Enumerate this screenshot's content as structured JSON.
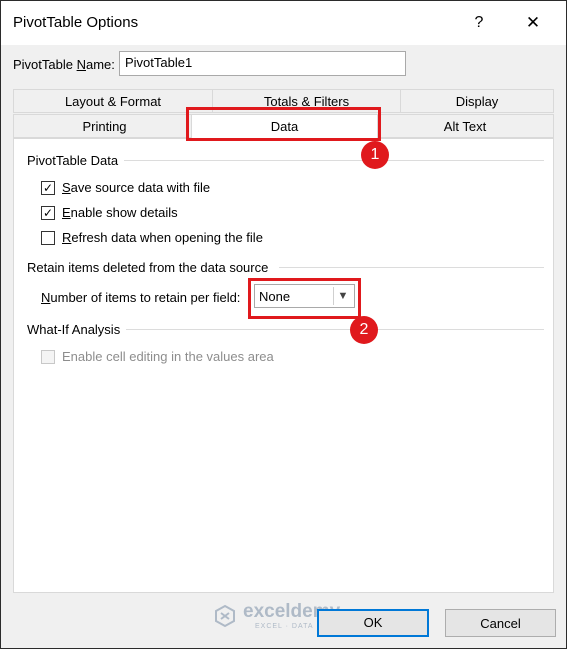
{
  "window": {
    "title": "PivotTable Options",
    "help_label": "?",
    "close_label": "✕"
  },
  "name_field": {
    "label_prefix": "PivotTable ",
    "label_accel": "N",
    "label_suffix": "ame:",
    "value": "PivotTable1"
  },
  "tabs": {
    "layout_format": "Layout & Format",
    "totals_filters": "Totals & Filters",
    "display": "Display",
    "printing": "Printing",
    "data": "Data",
    "alt_text": "Alt Text"
  },
  "sections": {
    "pivot_data": {
      "heading": "PivotTable Data",
      "save_source": {
        "accel": "S",
        "rest": "ave source data with file",
        "checked": true
      },
      "enable_details": {
        "accel": "E",
        "rest": "nable show details",
        "checked": true
      },
      "refresh_on_open": {
        "accel": "R",
        "rest": "efresh data when opening the file",
        "checked": false
      }
    },
    "retain_items": {
      "heading": "Retain items deleted from the data source",
      "label_accel": "N",
      "label_rest": "umber of items to retain per field:",
      "select_value": "None"
    },
    "what_if": {
      "heading": "What-If Analysis",
      "enable_editing": {
        "label": "Enable cell editing in the values area",
        "checked": false,
        "disabled": true
      }
    }
  },
  "annotations": {
    "badge1": "1",
    "badge2": "2",
    "highlight_color": "#e0191d"
  },
  "buttons": {
    "ok": "OK",
    "cancel": "Cancel"
  },
  "watermark": {
    "title": "exceldemy",
    "subtitle": "EXCEL · DATA · BI"
  },
  "icons": [
    "help-icon",
    "close-icon",
    "checkbox-checked-icon",
    "checkbox-empty-icon",
    "dropdown-arrow-icon",
    "exceldemy-logo-icon"
  ]
}
